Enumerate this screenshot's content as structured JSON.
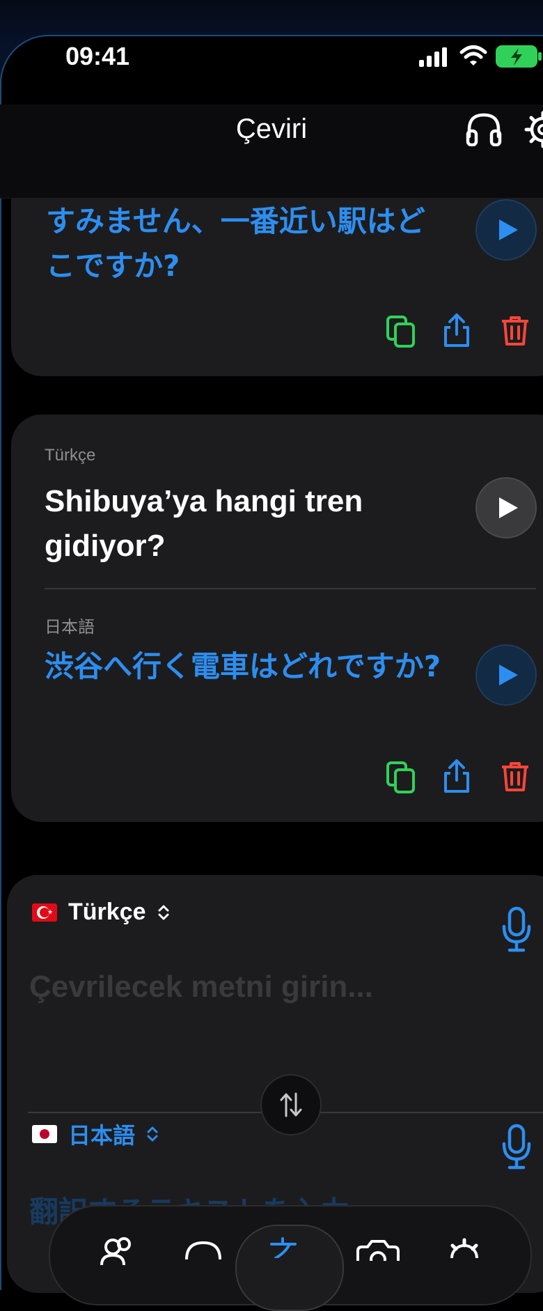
{
  "status_bar": {
    "time": "09:41"
  },
  "nav": {
    "title": "Çeviri"
  },
  "card1": {
    "translated_text": "すみません、一番近い駅はどこですか?"
  },
  "card2": {
    "source_lang": "Türkçe",
    "source_text": "Shibuya’ya hangi tren gidiyor?",
    "target_lang": "日本語",
    "translated_text": "渋谷へ行く電車はどれですか?"
  },
  "input": {
    "source_lang": "Türkçe",
    "source_placeholder": "Çevrilecek metni girin...",
    "target_lang": "日本語",
    "target_placeholder": "翻訳するテキストを入力"
  },
  "colors": {
    "accent_blue": "#2d8ef0",
    "copy_green": "#30d158",
    "delete_red": "#ff453a",
    "card_bg": "#1c1c1e"
  },
  "icons": [
    "headphones-icon",
    "gear-icon",
    "play-icon",
    "copy-icon",
    "share-icon",
    "trash-icon",
    "microphone-icon",
    "swap-icon",
    "people-icon",
    "chat-icon",
    "translate-icon",
    "camera-icon"
  ]
}
